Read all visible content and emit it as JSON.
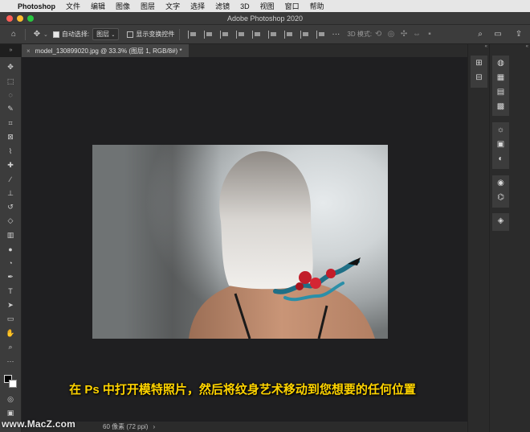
{
  "menubar": {
    "app": "Photoshop",
    "items": [
      "文件",
      "编辑",
      "图像",
      "图层",
      "文字",
      "选择",
      "滤镜",
      "3D",
      "视图",
      "窗口",
      "帮助"
    ]
  },
  "window": {
    "title": "Adobe Photoshop 2020",
    "traffic_colors": [
      "#ff5f57",
      "#febc2e",
      "#28c840"
    ]
  },
  "options": {
    "auto_select_label": "自动选择:",
    "auto_select_checked": true,
    "target_value": "图层",
    "show_transform_label": "显示变换控件",
    "show_transform_checked": false,
    "mode_3d_label": "3D 模式:"
  },
  "tab": {
    "close": "×",
    "label": "model_130899020.jpg @ 33.3% (图层 1, RGB/8#) *"
  },
  "tools": [
    {
      "name": "move-tool",
      "glyph": "✥"
    },
    {
      "name": "marquee-tool",
      "glyph": "⬚"
    },
    {
      "name": "lasso-tool",
      "glyph": "◌"
    },
    {
      "name": "quick-select-tool",
      "glyph": "✎"
    },
    {
      "name": "crop-tool",
      "glyph": "⌗"
    },
    {
      "name": "frame-tool",
      "glyph": "⊠"
    },
    {
      "name": "eyedropper-tool",
      "glyph": "⌇"
    },
    {
      "name": "healing-brush-tool",
      "glyph": "✚"
    },
    {
      "name": "brush-tool",
      "glyph": "∕"
    },
    {
      "name": "clone-stamp-tool",
      "glyph": "⊥"
    },
    {
      "name": "history-brush-tool",
      "glyph": "↺"
    },
    {
      "name": "eraser-tool",
      "glyph": "◇"
    },
    {
      "name": "gradient-tool",
      "glyph": "▥"
    },
    {
      "name": "blur-tool",
      "glyph": "●"
    },
    {
      "name": "dodge-tool",
      "glyph": "◔"
    },
    {
      "name": "pen-tool",
      "glyph": "✒"
    },
    {
      "name": "type-tool",
      "glyph": "T"
    },
    {
      "name": "path-selection-tool",
      "glyph": "➤"
    },
    {
      "name": "rectangle-tool",
      "glyph": "▭"
    },
    {
      "name": "hand-tool",
      "glyph": "✋"
    },
    {
      "name": "zoom-tool",
      "glyph": "⌕"
    },
    {
      "name": "more-tools",
      "glyph": "···"
    }
  ],
  "caption": "在 Ps 中打开模特照片，然后将纹身艺术移动到您想要的任何位置",
  "status": {
    "text": "60 像素 (72 ppi)",
    "arrow": "›"
  },
  "watermark": "www.MacZ.com",
  "colors": {
    "caption": "#ffd400",
    "ui_panel": "#3c3c3c",
    "canvas_bg": "#1f1f21"
  }
}
